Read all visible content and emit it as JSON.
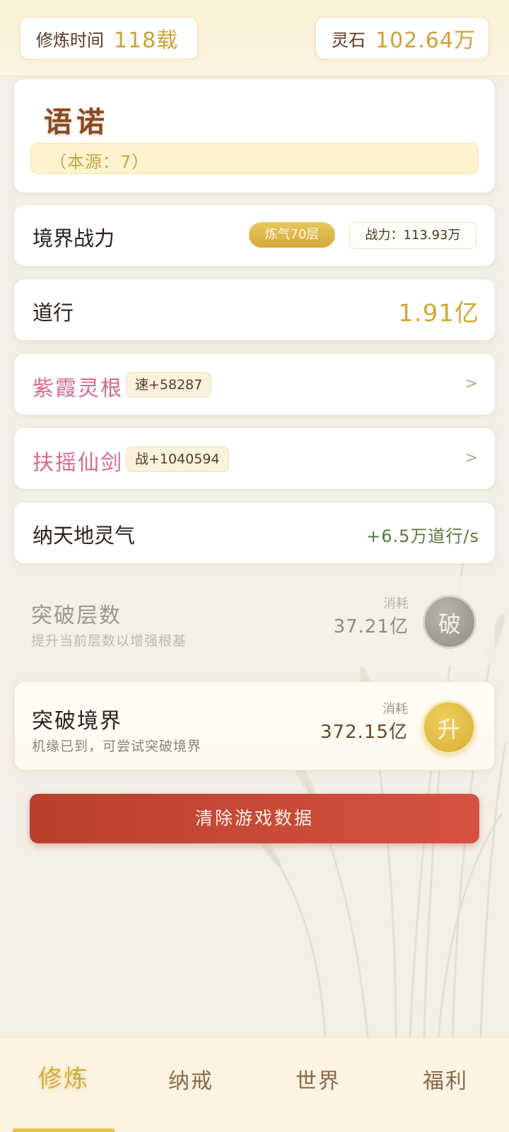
{
  "topbar": {
    "cultivation_time_label": "修炼时间",
    "cultivation_time_value": "118载",
    "spirit_stone_label": "灵石",
    "spirit_stone_value": "102.64万"
  },
  "profile": {
    "name": "语诺",
    "origin": "（本源：7）"
  },
  "realm": {
    "label": "境界战力",
    "level_badge": "炼气70层",
    "power": "战力：113.93万"
  },
  "dao": {
    "label": "道行",
    "value": "1.91亿"
  },
  "spirit_root": {
    "label": "紫霞灵根",
    "bonus": "速+58287",
    "chevron": ">"
  },
  "sword": {
    "label": "扶摇仙剑",
    "bonus": "战+1040594",
    "chevron": ">"
  },
  "absorb_qi": {
    "label": "纳天地灵气",
    "rate": "+6.5万道行/s"
  },
  "break_layer": {
    "title": "突破层数",
    "subtitle": "提升当前层数以增强根基",
    "cost_label": "消耗",
    "cost_value": "37.21亿",
    "button": "破"
  },
  "break_realm": {
    "title": "突破境界",
    "subtitle": "机缘已到，可尝试突破境界",
    "cost_label": "消耗",
    "cost_value": "372.15亿",
    "button": "升"
  },
  "clear_data_button": "清除游戏数据",
  "bottom_nav": {
    "items": [
      {
        "label": "修炼",
        "active": true
      },
      {
        "label": "纳戒",
        "active": false
      },
      {
        "label": "世界",
        "active": false
      },
      {
        "label": "福利",
        "active": false
      }
    ]
  },
  "colors": {
    "gold": "#d0a838",
    "pink": "#d96a8a",
    "green": "#587a3c",
    "red_button": "#c84836"
  }
}
